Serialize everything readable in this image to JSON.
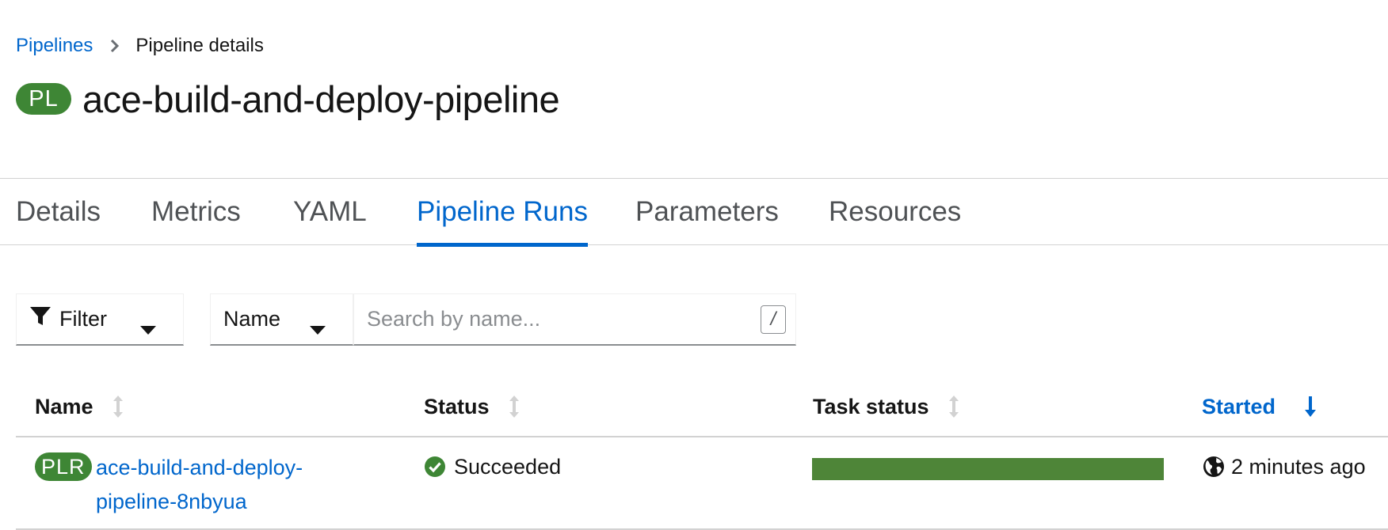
{
  "breadcrumb": {
    "parent": "Pipelines",
    "current": "Pipeline details"
  },
  "header": {
    "badge": "PL",
    "title": "ace-build-and-deploy-pipeline"
  },
  "tabs": [
    {
      "label": "Details"
    },
    {
      "label": "Metrics"
    },
    {
      "label": "YAML"
    },
    {
      "label": "Pipeline Runs",
      "active": true
    },
    {
      "label": "Parameters"
    },
    {
      "label": "Resources"
    }
  ],
  "toolbar": {
    "filter_label": "Filter",
    "attribute_select": "Name",
    "search_placeholder": "Search by name...",
    "search_value": "",
    "shortcut_hint": "/"
  },
  "table": {
    "columns": [
      {
        "label": "Name",
        "sort": "none"
      },
      {
        "label": "Status",
        "sort": "none"
      },
      {
        "label": "Task status",
        "sort": "none"
      },
      {
        "label": "Started",
        "sort": "descending"
      }
    ],
    "rows": [
      {
        "badge": "PLR",
        "name": "ace-build-and-deploy-pipeline-8nbyua",
        "status": "Succeeded",
        "task_progress": 1.0,
        "started": "2 minutes ago"
      }
    ]
  },
  "colors": {
    "link": "#0066cc",
    "success": "#3e8635",
    "task_bar": "#4e8538",
    "badge_bg": "#3e8635"
  },
  "icons": {
    "breadcrumb_separator": "chevron-right-icon",
    "filter": "filter-icon",
    "dropdown": "caret-down-icon",
    "sort_none": "sort-arrows-icon",
    "sort_desc": "arrow-down-icon",
    "status_ok": "check-circle-icon",
    "timestamp": "globe-icon"
  }
}
